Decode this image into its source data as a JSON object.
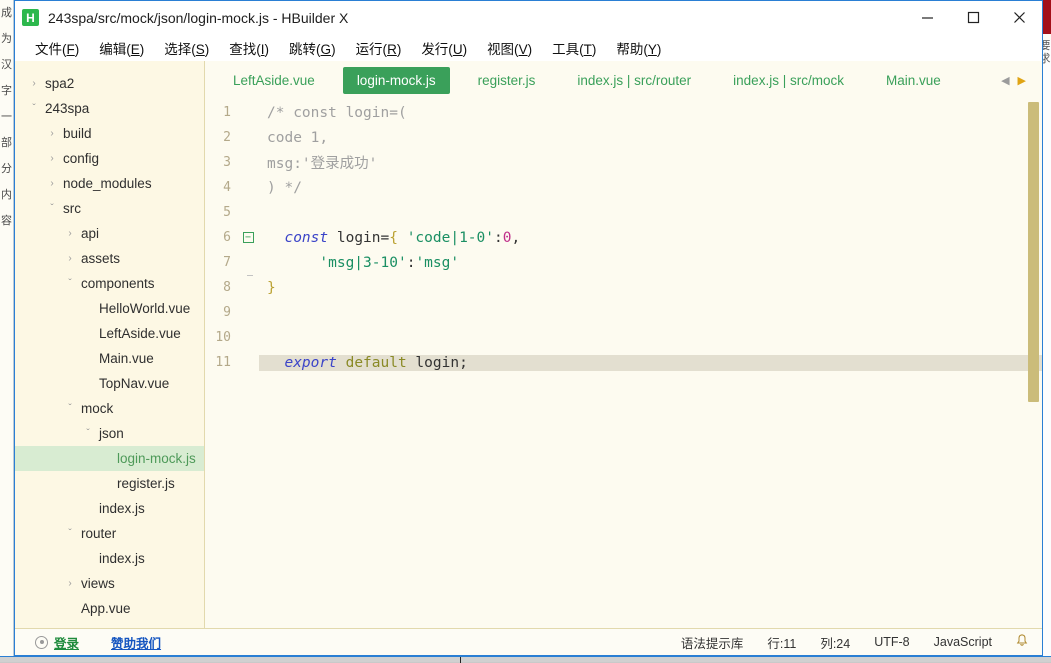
{
  "window": {
    "title": "243spa/src/mock/json/login-mock.js - HBuilder X",
    "logo_letter": "H",
    "controls": {
      "minimize": "minimize-icon",
      "maximize": "maximize-icon",
      "close": "close-icon"
    }
  },
  "menubar": [
    {
      "label": "文件(F)"
    },
    {
      "label": "编辑(E)"
    },
    {
      "label": "选择(S)"
    },
    {
      "label": "查找(I)"
    },
    {
      "label": "跳转(G)"
    },
    {
      "label": "运行(R)"
    },
    {
      "label": "发行(U)"
    },
    {
      "label": "视图(V)"
    },
    {
      "label": "工具(T)"
    },
    {
      "label": "帮助(Y)"
    }
  ],
  "sidebar": {
    "items": [
      {
        "label": "spa2",
        "indent": 0,
        "arrow": "›",
        "selected": false
      },
      {
        "label": "243spa",
        "indent": 0,
        "arrow": "⌄",
        "selected": false
      },
      {
        "label": "build",
        "indent": 1,
        "arrow": "›",
        "selected": false
      },
      {
        "label": "config",
        "indent": 1,
        "arrow": "›",
        "selected": false
      },
      {
        "label": "node_modules",
        "indent": 1,
        "arrow": "›",
        "selected": false
      },
      {
        "label": "src",
        "indent": 1,
        "arrow": "⌄",
        "selected": false
      },
      {
        "label": "api",
        "indent": 2,
        "arrow": "›",
        "selected": false
      },
      {
        "label": "assets",
        "indent": 2,
        "arrow": "›",
        "selected": false
      },
      {
        "label": "components",
        "indent": 2,
        "arrow": "⌄",
        "selected": false
      },
      {
        "label": "HelloWorld.vue",
        "indent": 3,
        "arrow": "",
        "selected": false
      },
      {
        "label": "LeftAside.vue",
        "indent": 3,
        "arrow": "",
        "selected": false
      },
      {
        "label": "Main.vue",
        "indent": 3,
        "arrow": "",
        "selected": false
      },
      {
        "label": "TopNav.vue",
        "indent": 3,
        "arrow": "",
        "selected": false
      },
      {
        "label": "mock",
        "indent": 2,
        "arrow": "⌄",
        "selected": false
      },
      {
        "label": "json",
        "indent": 3,
        "arrow": "⌄",
        "selected": false
      },
      {
        "label": "login-mock.js",
        "indent": 4,
        "arrow": "",
        "selected": true
      },
      {
        "label": "register.js",
        "indent": 4,
        "arrow": "",
        "selected": false
      },
      {
        "label": "index.js",
        "indent": 3,
        "arrow": "",
        "selected": false
      },
      {
        "label": "router",
        "indent": 2,
        "arrow": "⌄",
        "selected": false
      },
      {
        "label": "index.js",
        "indent": 3,
        "arrow": "",
        "selected": false
      },
      {
        "label": "views",
        "indent": 2,
        "arrow": "›",
        "selected": false
      },
      {
        "label": "App.vue",
        "indent": 2,
        "arrow": "",
        "selected": false
      }
    ]
  },
  "tabs": {
    "items": [
      {
        "label": "LeftAside.vue",
        "active": false
      },
      {
        "label": "login-mock.js",
        "active": true
      },
      {
        "label": "register.js",
        "active": false
      },
      {
        "label": "index.js | src/router",
        "active": false
      },
      {
        "label": "index.js | src/mock",
        "active": false
      },
      {
        "label": "Main.vue",
        "active": false
      }
    ],
    "nav_prev": "◀",
    "nav_next": "▶"
  },
  "editor": {
    "lines": [
      {
        "num": "1",
        "fold": "none",
        "current": false,
        "tokens": [
          {
            "t": "/* const login=(",
            "c": "t-com"
          }
        ]
      },
      {
        "num": "2",
        "fold": "none",
        "current": false,
        "tokens": [
          {
            "t": "code 1,",
            "c": "t-com"
          }
        ]
      },
      {
        "num": "3",
        "fold": "none",
        "current": false,
        "tokens": [
          {
            "t": "msg:'登录成功'",
            "c": "t-com"
          }
        ]
      },
      {
        "num": "4",
        "fold": "none",
        "current": false,
        "tokens": [
          {
            "t": ") */",
            "c": "t-com"
          }
        ]
      },
      {
        "num": "5",
        "fold": "none",
        "current": false,
        "tokens": []
      },
      {
        "num": "6",
        "fold": "open",
        "current": false,
        "tokens": [
          {
            "t": "  ",
            "c": "t-pln"
          },
          {
            "t": "const",
            "c": "t-kw"
          },
          {
            "t": " login=",
            "c": "t-pln"
          },
          {
            "t": "{",
            "c": "t-brc"
          },
          {
            "t": " ",
            "c": "t-pln"
          },
          {
            "t": "'code|1-0'",
            "c": "t-str"
          },
          {
            "t": ":",
            "c": "t-op"
          },
          {
            "t": "0",
            "c": "t-num"
          },
          {
            "t": ",",
            "c": "t-op"
          }
        ]
      },
      {
        "num": "7",
        "fold": "guide",
        "current": false,
        "tokens": [
          {
            "t": "      ",
            "c": "t-pln"
          },
          {
            "t": "'msg|3-10'",
            "c": "t-str"
          },
          {
            "t": ":",
            "c": "t-op"
          },
          {
            "t": "'msg'",
            "c": "t-str"
          }
        ]
      },
      {
        "num": "8",
        "fold": "end",
        "current": false,
        "tokens": [
          {
            "t": "}",
            "c": "t-brc"
          }
        ]
      },
      {
        "num": "9",
        "fold": "none",
        "current": false,
        "tokens": []
      },
      {
        "num": "10",
        "fold": "none",
        "current": false,
        "tokens": []
      },
      {
        "num": "11",
        "fold": "none",
        "current": true,
        "tokens": [
          {
            "t": "  ",
            "c": "t-pln"
          },
          {
            "t": "export",
            "c": "t-kw"
          },
          {
            "t": " ",
            "c": "t-pln"
          },
          {
            "t": "default",
            "c": "t-kw2"
          },
          {
            "t": " login;",
            "c": "t-pln"
          }
        ]
      }
    ]
  },
  "statusbar": {
    "login": "登录",
    "sponsor": "赞助我们",
    "syntax_lib": "语法提示库",
    "row": "行:11",
    "col": "列:24",
    "encoding": "UTF-8",
    "language": "JavaScript",
    "bell": "🔔"
  },
  "background": {
    "left_text": "成\n为\n汉\n字\n一\n部\n分\n内\n容",
    "right_text": "要\n求"
  },
  "colors": {
    "accent_green": "#3aa05a",
    "window_border": "#2a7fd4",
    "editor_bg": "#fdfbf0",
    "sidebar_bg": "#fdf8e4",
    "selection_bg": "#d8ecd2"
  }
}
